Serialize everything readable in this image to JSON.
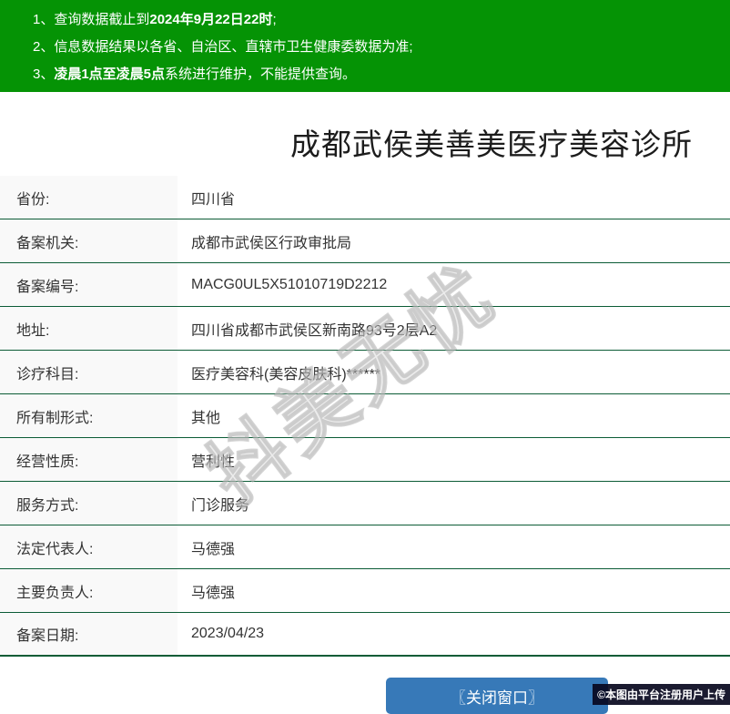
{
  "banner": {
    "bg_color": "#059305",
    "notices": [
      {
        "num": "1、",
        "pre": "查询数据截止到",
        "bold": "2024年9月22日22时",
        "post": ";"
      },
      {
        "num": "2、",
        "pre": "信息数据结果以各省、自治区、直辖市卫生健康委数据为准;",
        "bold": "",
        "post": ""
      },
      {
        "num": "3、",
        "pre": "",
        "bold": "凌晨1点至凌晨5点",
        "post": "系统进行维护，不能提供查询。"
      }
    ]
  },
  "title": "成都武侯美善美医疗美容诊所",
  "table": {
    "label_bg_color": "#f9f9f9",
    "divider_color": "#0c5c36",
    "rows": [
      {
        "label": "省份:",
        "value": "四川省"
      },
      {
        "label": "备案机关:",
        "value": "成都市武侯区行政审批局"
      },
      {
        "label": "备案编号:",
        "value": "MACG0UL5X51010719D2212"
      },
      {
        "label": "地址:",
        "value": "四川省成都市武侯区新南路93号2层A2"
      },
      {
        "label": "诊疗科目:",
        "value": "医疗美容科(美容皮肤科)******"
      },
      {
        "label": "所有制形式:",
        "value": "其他"
      },
      {
        "label": "经营性质:",
        "value": "营利性"
      },
      {
        "label": "服务方式:",
        "value": "门诊服务"
      },
      {
        "label": "法定代表人:",
        "value": "马德强"
      },
      {
        "label": "主要负责人:",
        "value": "马德强"
      },
      {
        "label": "备案日期:",
        "value": "2023/04/23"
      }
    ]
  },
  "watermark": "抖美无忧",
  "close_button": {
    "label": "〖关闭窗口〗",
    "bg_color": "#3779b8"
  },
  "image_credit": "©本图由平台注册用户上传"
}
